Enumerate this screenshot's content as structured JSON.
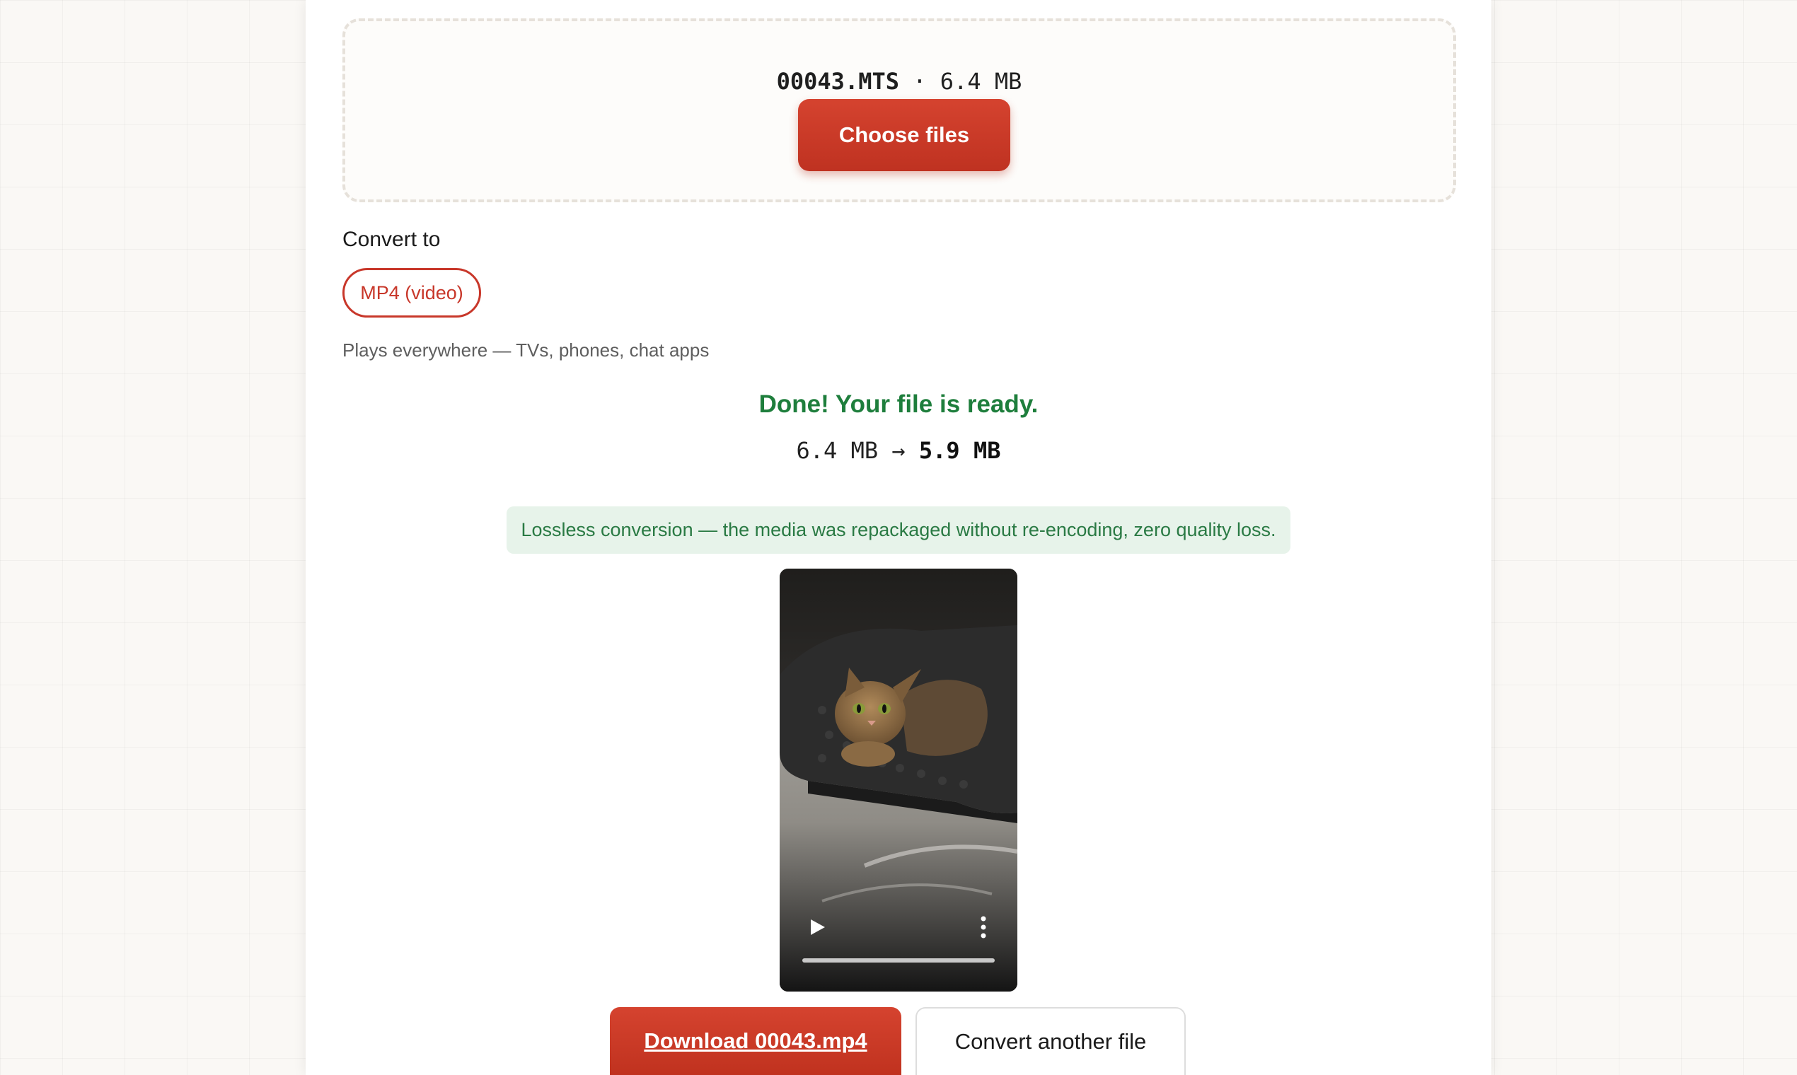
{
  "upload": {
    "file_name": "00043.MTS",
    "separator": " · ",
    "file_size": "6.4 MB",
    "choose_button_label": "Choose files"
  },
  "convert": {
    "label": "Convert to",
    "selected_format": "MP4 (video)",
    "hint": "Plays everywhere — TVs, phones, chat apps"
  },
  "result": {
    "status": "Done! Your file is ready.",
    "original_size": "6.4 MB",
    "arrow": " → ",
    "new_size": "5.9 MB",
    "notice": "Lossless conversion — the media was repackaged without re-encoding, zero quality loss."
  },
  "player": {
    "play_icon": "play-icon",
    "menu_icon": "more-vertical-icon",
    "progress": 0
  },
  "actions": {
    "download_label": "Download 00043.mp4",
    "another_label": "Convert another file"
  },
  "colors": {
    "accent": "#c8372a",
    "success": "#1e7e3c",
    "notice_bg": "#e7f3ea"
  }
}
